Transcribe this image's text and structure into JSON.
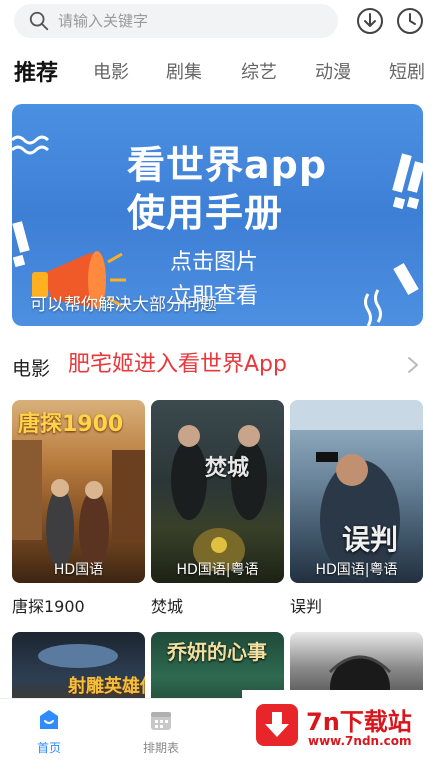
{
  "search": {
    "placeholder": "请输入关键字"
  },
  "tabs": [
    {
      "label": "推荐",
      "active": true
    },
    {
      "label": "电影"
    },
    {
      "label": "剧集"
    },
    {
      "label": "综艺"
    },
    {
      "label": "动漫"
    },
    {
      "label": "短剧"
    }
  ],
  "banner": {
    "line1": "看世界app",
    "line2": "使用手册",
    "sub1": "点击图片",
    "sub2": "立即查看",
    "caption": "可以帮你解决大部分问题"
  },
  "section": {
    "title": "电影",
    "overlay": "肥宅姬进入看世界App"
  },
  "movies": [
    {
      "name": "唐探1900",
      "badge": "HD国语",
      "poster_text": "唐探1900"
    },
    {
      "name": "焚城",
      "badge": "HD国语|粤语",
      "poster_text": "焚城"
    },
    {
      "name": "误判",
      "badge": "HD国语|粤语",
      "poster_text": "误判"
    }
  ],
  "movies_row2": [
    {
      "poster_text": "射雕英雄传"
    },
    {
      "poster_text": "乔妍的心事"
    },
    {
      "poster_text": ""
    }
  ],
  "bottom_nav": [
    {
      "label": "首页",
      "active": true
    },
    {
      "label": "排期表"
    }
  ],
  "watermark": {
    "brand": "7n下载站",
    "url": "www.7ndn.com"
  },
  "colors": {
    "accent": "#2f8cff",
    "red": "#e8383c",
    "banner": "#4a90e2"
  }
}
